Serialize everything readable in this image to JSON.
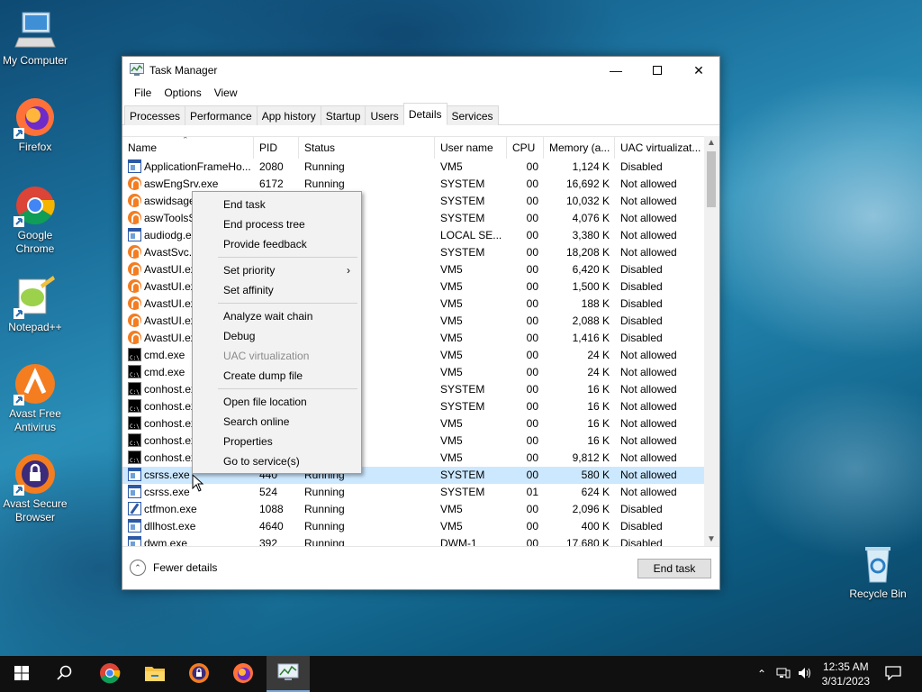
{
  "desktop": {
    "icons": [
      {
        "label": "My Computer"
      },
      {
        "label": "Firefox"
      },
      {
        "label": "Google Chrome"
      },
      {
        "label": "Notepad++"
      },
      {
        "label": "Avast Free Antivirus"
      },
      {
        "label": "Avast Secure Browser"
      },
      {
        "label": "Recycle Bin"
      }
    ]
  },
  "window": {
    "title": "Task Manager",
    "menu": [
      "File",
      "Options",
      "View"
    ],
    "tabs": [
      "Processes",
      "Performance",
      "App history",
      "Startup",
      "Users",
      "Details",
      "Services"
    ],
    "active_tab": "Details",
    "columns": [
      "Name",
      "PID",
      "Status",
      "User name",
      "CPU",
      "Memory (a...",
      "UAC virtualizat..."
    ],
    "rows": [
      {
        "icon": "win",
        "name": "ApplicationFrameHo...",
        "pid": "2080",
        "status": "Running",
        "user": "VM5",
        "cpu": "00",
        "mem": "1,124 K",
        "uac": "Disabled"
      },
      {
        "icon": "av",
        "name": "aswEngSrv.exe",
        "pid": "6172",
        "status": "Running",
        "user": "SYSTEM",
        "cpu": "00",
        "mem": "16,692 K",
        "uac": "Not allowed"
      },
      {
        "icon": "av",
        "name": "aswidsage",
        "pid": "",
        "status": "",
        "user": "SYSTEM",
        "cpu": "00",
        "mem": "10,032 K",
        "uac": "Not allowed"
      },
      {
        "icon": "av",
        "name": "aswToolsS",
        "pid": "",
        "status": "",
        "user": "SYSTEM",
        "cpu": "00",
        "mem": "4,076 K",
        "uac": "Not allowed"
      },
      {
        "icon": "win",
        "name": "audiodg.e",
        "pid": "",
        "status": "",
        "user": "LOCAL SE...",
        "cpu": "00",
        "mem": "3,380 K",
        "uac": "Not allowed"
      },
      {
        "icon": "av",
        "name": "AvastSvc.e",
        "pid": "",
        "status": "",
        "user": "SYSTEM",
        "cpu": "00",
        "mem": "18,208 K",
        "uac": "Not allowed"
      },
      {
        "icon": "av",
        "name": "AvastUI.ex",
        "pid": "",
        "status": "",
        "user": "VM5",
        "cpu": "00",
        "mem": "6,420 K",
        "uac": "Disabled"
      },
      {
        "icon": "av",
        "name": "AvastUI.ex",
        "pid": "",
        "status": "",
        "user": "VM5",
        "cpu": "00",
        "mem": "1,500 K",
        "uac": "Disabled"
      },
      {
        "icon": "av",
        "name": "AvastUI.ex",
        "pid": "",
        "status": "",
        "user": "VM5",
        "cpu": "00",
        "mem": "188 K",
        "uac": "Disabled"
      },
      {
        "icon": "av",
        "name": "AvastUI.ex",
        "pid": "",
        "status": "",
        "user": "VM5",
        "cpu": "00",
        "mem": "2,088 K",
        "uac": "Disabled"
      },
      {
        "icon": "av",
        "name": "AvastUI.ex",
        "pid": "",
        "status": "",
        "user": "VM5",
        "cpu": "00",
        "mem": "1,416 K",
        "uac": "Disabled"
      },
      {
        "icon": "cmd",
        "name": "cmd.exe",
        "pid": "",
        "status": "",
        "user": "VM5",
        "cpu": "00",
        "mem": "24 K",
        "uac": "Not allowed"
      },
      {
        "icon": "cmd",
        "name": "cmd.exe",
        "pid": "",
        "status": "",
        "user": "VM5",
        "cpu": "00",
        "mem": "24 K",
        "uac": "Not allowed"
      },
      {
        "icon": "cmd",
        "name": "conhost.ex",
        "pid": "",
        "status": "",
        "user": "SYSTEM",
        "cpu": "00",
        "mem": "16 K",
        "uac": "Not allowed"
      },
      {
        "icon": "cmd",
        "name": "conhost.ex",
        "pid": "",
        "status": "",
        "user": "SYSTEM",
        "cpu": "00",
        "mem": "16 K",
        "uac": "Not allowed"
      },
      {
        "icon": "cmd",
        "name": "conhost.ex",
        "pid": "",
        "status": "",
        "user": "VM5",
        "cpu": "00",
        "mem": "16 K",
        "uac": "Not allowed"
      },
      {
        "icon": "cmd",
        "name": "conhost.ex",
        "pid": "",
        "status": "",
        "user": "VM5",
        "cpu": "00",
        "mem": "16 K",
        "uac": "Not allowed"
      },
      {
        "icon": "cmd",
        "name": "conhost.ex",
        "pid": "",
        "status": "",
        "user": "VM5",
        "cpu": "00",
        "mem": "9,812 K",
        "uac": "Not allowed"
      },
      {
        "icon": "win",
        "name": "csrss.exe",
        "pid": "440",
        "status": "Running",
        "user": "SYSTEM",
        "cpu": "00",
        "mem": "580 K",
        "uac": "Not allowed",
        "selected": true
      },
      {
        "icon": "win",
        "name": "csrss.exe",
        "pid": "524",
        "status": "Running",
        "user": "SYSTEM",
        "cpu": "01",
        "mem": "624 K",
        "uac": "Not allowed"
      },
      {
        "icon": "pen",
        "name": "ctfmon.exe",
        "pid": "1088",
        "status": "Running",
        "user": "VM5",
        "cpu": "00",
        "mem": "2,096 K",
        "uac": "Disabled"
      },
      {
        "icon": "win",
        "name": "dllhost.exe",
        "pid": "4640",
        "status": "Running",
        "user": "VM5",
        "cpu": "00",
        "mem": "400 K",
        "uac": "Disabled"
      },
      {
        "icon": "win",
        "name": "dwm.exe",
        "pid": "392",
        "status": "Running",
        "user": "DWM-1",
        "cpu": "00",
        "mem": "17,680 K",
        "uac": "Disabled"
      }
    ],
    "fewer_details": "Fewer details",
    "end_task": "End task"
  },
  "context_menu": {
    "groups": [
      [
        {
          "label": "End task"
        },
        {
          "label": "End process tree"
        },
        {
          "label": "Provide feedback"
        }
      ],
      [
        {
          "label": "Set priority",
          "submenu": true
        },
        {
          "label": "Set affinity"
        }
      ],
      [
        {
          "label": "Analyze wait chain"
        },
        {
          "label": "Debug"
        },
        {
          "label": "UAC virtualization",
          "disabled": true
        },
        {
          "label": "Create dump file"
        }
      ],
      [
        {
          "label": "Open file location"
        },
        {
          "label": "Search online"
        },
        {
          "label": "Properties"
        },
        {
          "label": "Go to service(s)"
        }
      ]
    ]
  },
  "taskbar": {
    "time": "12:35 AM",
    "date": "3/31/2023"
  }
}
